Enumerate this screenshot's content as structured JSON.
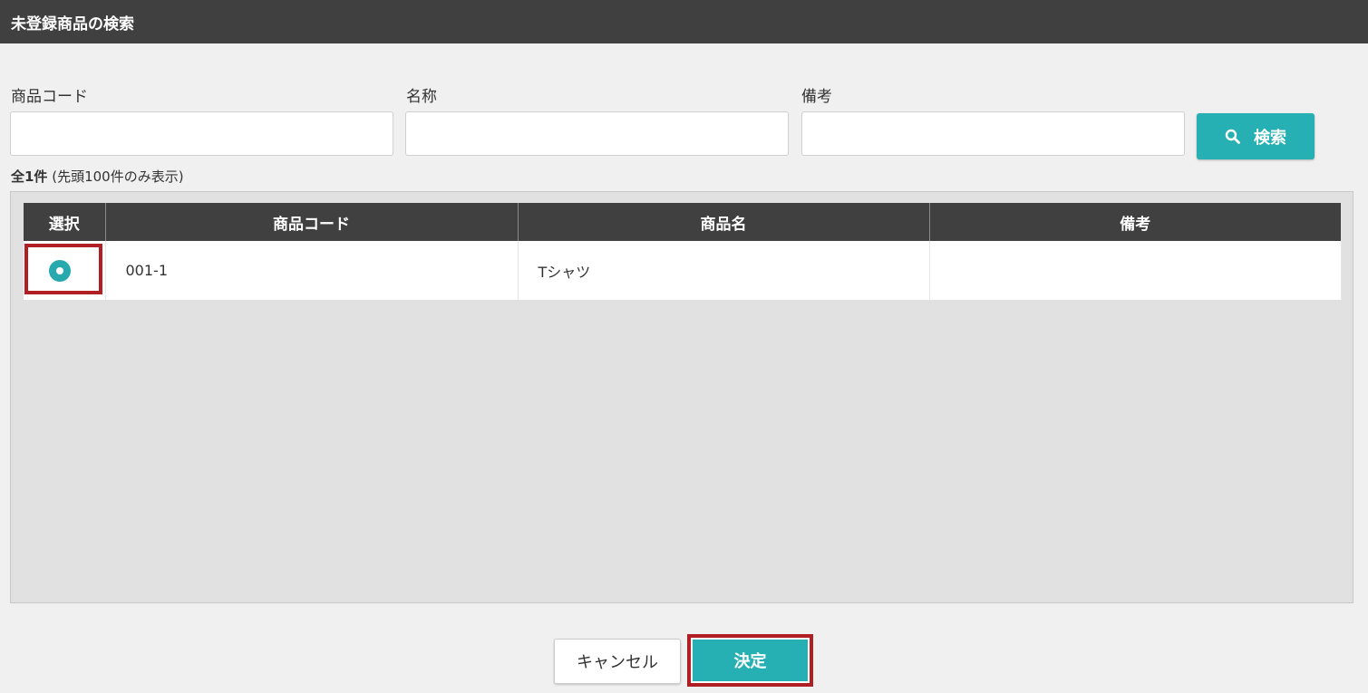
{
  "window": {
    "title": "未登録商品の検索"
  },
  "search": {
    "code_label": "商品コード",
    "code_value": "",
    "name_label": "名称",
    "name_value": "",
    "note_label": "備考",
    "note_value": "",
    "button_label": "検索",
    "button_icon": "search-icon"
  },
  "results": {
    "count_total": "全1件",
    "count_note": "(先頭100件のみ表示)",
    "columns": [
      "選択",
      "商品コード",
      "商品名",
      "備考"
    ],
    "rows": [
      {
        "selected": true,
        "code": "001-1",
        "name": "Tシャツ",
        "note": ""
      }
    ]
  },
  "footer": {
    "cancel_label": "キャンセル",
    "ok_label": "決定"
  },
  "colors": {
    "header_bg": "#404040",
    "accent": "#27b0b4",
    "highlight": "#b01f24",
    "panel_bg": "#e1e1e1"
  }
}
